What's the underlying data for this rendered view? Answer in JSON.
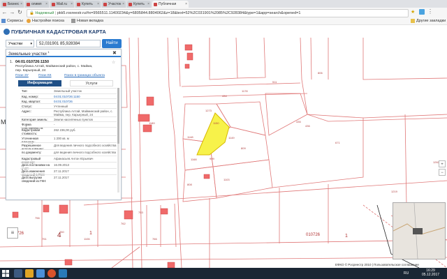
{
  "browser": {
    "tabs": [
      {
        "label": "Бизнес"
      },
      {
        "label": "олимп"
      },
      {
        "label": "Mail.ru"
      },
      {
        "label": "Купить"
      },
      {
        "label": "Участок"
      },
      {
        "label": "Купить"
      },
      {
        "label": "Публичная"
      }
    ],
    "address": {
      "secure_label": "Надежный",
      "url": "pkk5.rosreestr.ru/#x=9565511.11400234&y=6805844.8804062&z=18&text=52%2C031901%2085%2C928384&type=1&app=search&opened=1"
    },
    "bookmarks": [
      {
        "label": "Сервисы"
      },
      {
        "label": "Настройки поиска"
      },
      {
        "label": "Новая вкладка"
      }
    ],
    "other_bookmarks": "Другие закладки"
  },
  "site": {
    "title": "ПУБЛИЧНАЯ КАДАСТРОВАЯ КАРТА"
  },
  "search": {
    "type_value": "Участки",
    "query": "52,031901 85,928384",
    "find_label": "Найти"
  },
  "panel": {
    "title": "Земельные участки",
    "count": "1",
    "object": {
      "index": "1.",
      "cad_number": "04:01:010726:1150",
      "address": "Республика Алтай, Майминский район, с. Майма, пер. Карьерный, 24",
      "links": [
        "План ЗУ",
        "План КК",
        "Поиск в границах объекта"
      ]
    },
    "tabs": {
      "info": "Информация",
      "services": "Услуги"
    },
    "attributes": [
      {
        "label": "Тип:",
        "value": "Земельный участок",
        "link": false
      },
      {
        "label": "Кад. номер:",
        "value": "04:01:010726:1150",
        "link": true
      },
      {
        "label": "Кад. квартал:",
        "value": "04:01:010726",
        "link": true
      },
      {
        "label": "Статус:",
        "value": "Учтенный",
        "link": false
      },
      {
        "label": "Адрес:",
        "value": "Республика Алтай, Майминский район, с. Майма, пер. Карьерный, 24",
        "link": false
      },
      {
        "label": "Категория земель:",
        "value": "Земли населённых пунктов",
        "link": false
      },
      {
        "label": "Форма собственности:",
        "value": "-",
        "link": false
      },
      {
        "label": "Кадастровая стоимость:",
        "value": "262 236,00 руб.",
        "link": false
      },
      {
        "label": "Уточненная площадь:",
        "value": "1 200 кв. м",
        "link": false
      },
      {
        "label": "Разрешенное использование:",
        "value": "Для ведения личного подсобного хозяйства",
        "link": false
      },
      {
        "label": "по документу:",
        "value": "для ведения личного подсобного хозяйства",
        "link": false
      },
      {
        "label": "Кадастровый инженер:",
        "value": "Афанасьев Антон Юрьевич",
        "link": false
      },
      {
        "label": "Дата постановки на учет:",
        "value": "16.09.2013",
        "link": false
      },
      {
        "label": "Дата изменения сведений в ГКН:",
        "value": "27.11.2017",
        "link": false
      },
      {
        "label": "Дата выгрузки сведений из ГКН:",
        "value": "27.11.2017",
        "link": false
      }
    ]
  },
  "map": {
    "parcel_labels": [
      "1150",
      "1273",
      "434",
      "1178",
      "1148",
      "1149",
      "809",
      "1168",
      "999",
      "808",
      "1103",
      "435",
      "436",
      "1189",
      "671",
      "511",
      "806",
      "753",
      "762",
      "766",
      "751",
      "750",
      "1106",
      "756",
      "1219",
      "1262"
    ],
    "quarter_label": "010726",
    "quarter_label_left": "010726",
    "district_numbers": [
      "4",
      "1",
      "1"
    ],
    "highlight_color": "#f7f24a",
    "boundary_color": "#e07878",
    "building_color": "#f06a6a",
    "attribution": "ЕФКО © Росреестр 2010 | Пользовательское соглашение",
    "controls": [
      "plus-icon",
      "minus-icon"
    ]
  },
  "taskbar": {
    "lang": "RU",
    "time": "16:29",
    "date": "05.12.2017"
  }
}
